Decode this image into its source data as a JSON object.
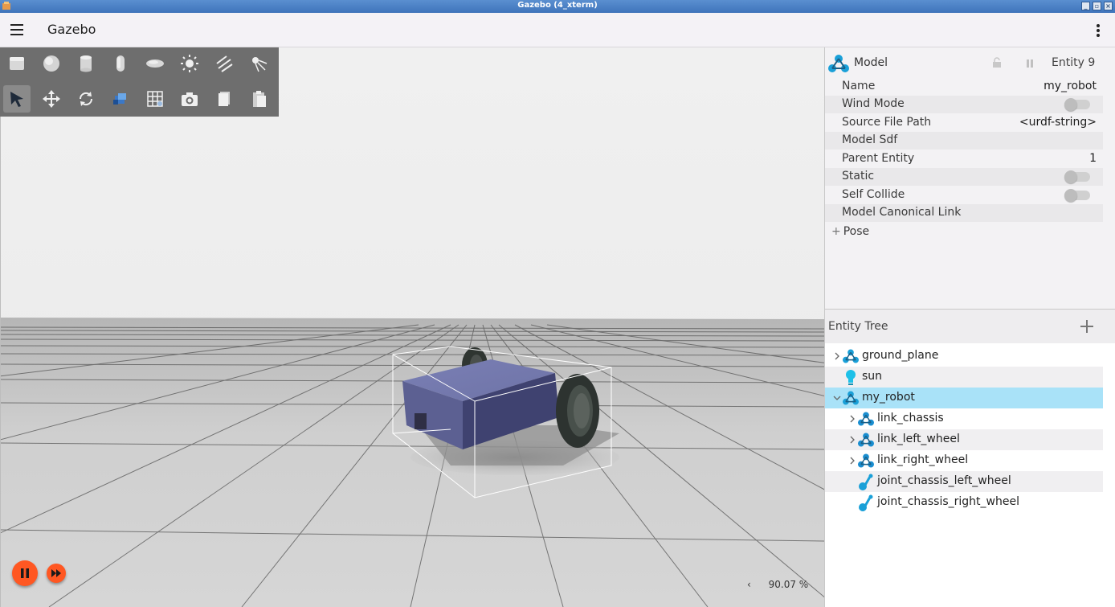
{
  "window": {
    "title": "Gazebo (4_xterm)"
  },
  "app": {
    "title": "Gazebo"
  },
  "toolbar": {
    "row1": [
      "box",
      "sphere",
      "cylinder",
      "capsule",
      "ellipsoid",
      "point-light",
      "directional-light",
      "spot-light"
    ],
    "row2": [
      "select",
      "translate",
      "rotate",
      "transform-control",
      "grid",
      "screenshot",
      "copy",
      "paste"
    ]
  },
  "stats": {
    "rtf": "90.07 %",
    "arrow": "‹"
  },
  "component": {
    "title": "Model",
    "entity": "Entity 9",
    "props": [
      {
        "key": "Name",
        "value": "my_robot"
      },
      {
        "key": "Wind Mode",
        "toggle": false
      },
      {
        "key": "Source File Path",
        "value": "<urdf-string>"
      },
      {
        "key": "Model Sdf",
        "value": ""
      },
      {
        "key": "Parent Entity",
        "value": "1"
      },
      {
        "key": "Static",
        "toggle": false
      },
      {
        "key": "Self Collide",
        "toggle": false
      },
      {
        "key": "Model Canonical Link",
        "value": ""
      }
    ],
    "pose_label": "Pose"
  },
  "tree": {
    "title": "Entity Tree",
    "items": [
      {
        "label": "ground_plane",
        "icon": "model-icon",
        "level": 0,
        "expander": "collapsed"
      },
      {
        "label": "sun",
        "icon": "light-bulb-icon",
        "level": 0,
        "expander": "none"
      },
      {
        "label": "my_robot",
        "icon": "model-icon",
        "level": 0,
        "expander": "expanded",
        "selected": true
      },
      {
        "label": "link_chassis",
        "icon": "link-icon",
        "level": 1,
        "expander": "collapsed"
      },
      {
        "label": "link_left_wheel",
        "icon": "link-icon",
        "level": 1,
        "expander": "collapsed"
      },
      {
        "label": "link_right_wheel",
        "icon": "link-icon",
        "level": 1,
        "expander": "collapsed"
      },
      {
        "label": "joint_chassis_left_wheel",
        "icon": "joint-icon",
        "level": 1,
        "expander": "none"
      },
      {
        "label": "joint_chassis_right_wheel",
        "icon": "joint-icon",
        "level": 1,
        "expander": "none"
      }
    ]
  },
  "colors": {
    "accent": "#ff5722",
    "selection": "#a9e2f8",
    "robot_body": "#6a6fa0",
    "icon_blue": "#1aa0d8"
  }
}
